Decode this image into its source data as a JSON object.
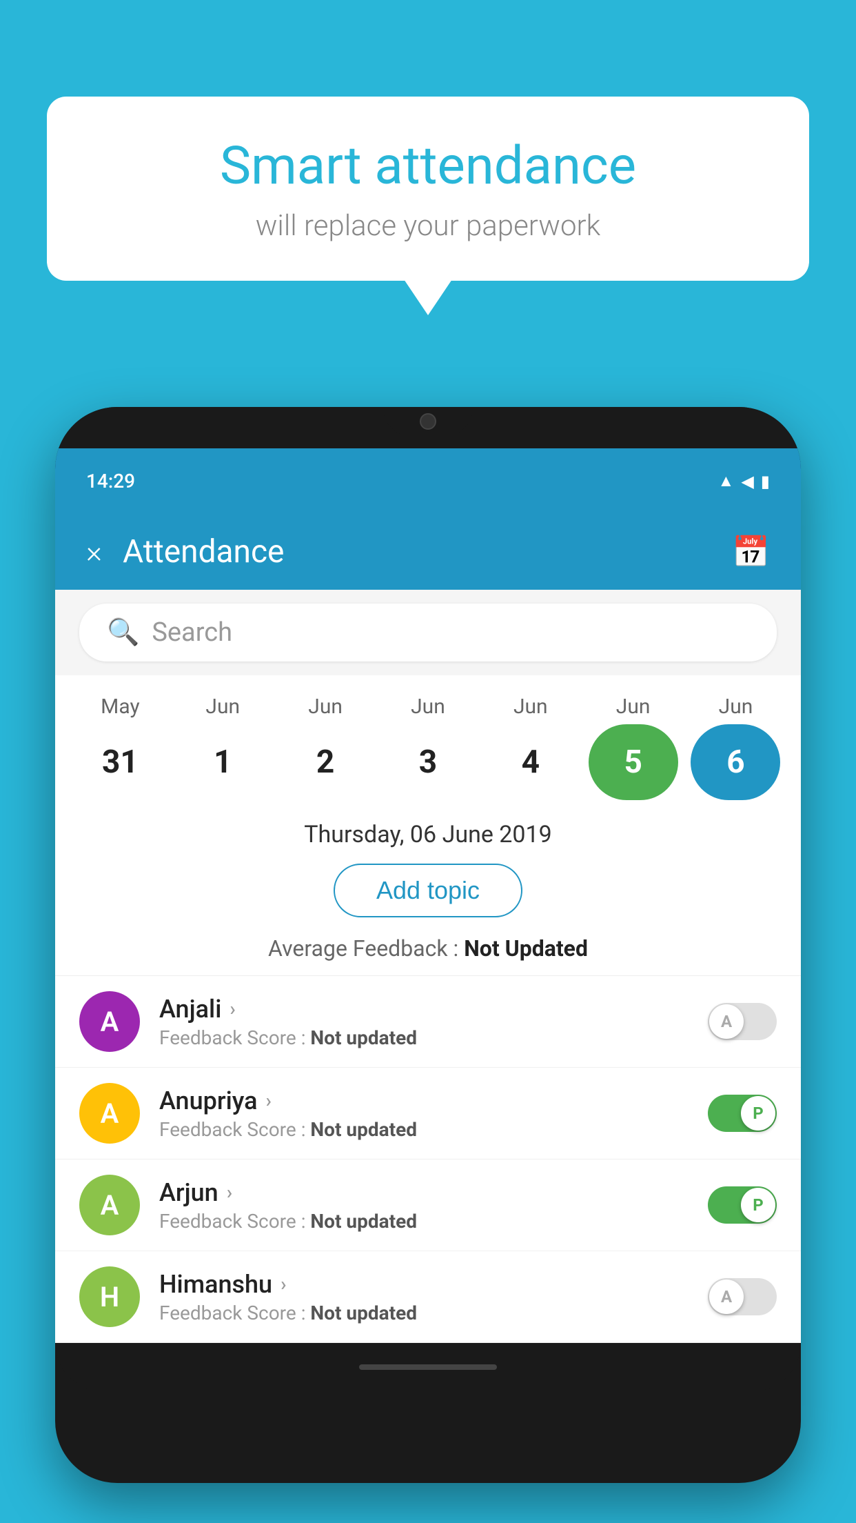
{
  "background_color": "#29b6d8",
  "speech_bubble": {
    "title": "Smart attendance",
    "subtitle": "will replace your paperwork"
  },
  "status_bar": {
    "time": "14:29",
    "icons": [
      "wifi",
      "signal",
      "battery"
    ]
  },
  "app_bar": {
    "title": "Attendance",
    "close_label": "×"
  },
  "search": {
    "placeholder": "Search"
  },
  "calendar": {
    "months": [
      "May",
      "Jun",
      "Jun",
      "Jun",
      "Jun",
      "Jun",
      "Jun"
    ],
    "dates": [
      "31",
      "1",
      "2",
      "3",
      "4",
      "5",
      "6"
    ],
    "today_index": 5,
    "selected_index": 6
  },
  "selected_date": "Thursday, 06 June 2019",
  "add_topic_label": "Add topic",
  "average_feedback": {
    "label": "Average Feedback : ",
    "value": "Not Updated"
  },
  "students": [
    {
      "name": "Anjali",
      "avatar_letter": "A",
      "avatar_color": "#9c27b0",
      "feedback_label": "Feedback Score : ",
      "feedback_value": "Not updated",
      "toggle": "off",
      "toggle_letter": "A"
    },
    {
      "name": "Anupriya",
      "avatar_letter": "A",
      "avatar_color": "#ffc107",
      "feedback_label": "Feedback Score : ",
      "feedback_value": "Not updated",
      "toggle": "on",
      "toggle_letter": "P"
    },
    {
      "name": "Arjun",
      "avatar_letter": "A",
      "avatar_color": "#8bc34a",
      "feedback_label": "Feedback Score : ",
      "feedback_value": "Not updated",
      "toggle": "on",
      "toggle_letter": "P"
    },
    {
      "name": "Himanshu",
      "avatar_letter": "H",
      "avatar_color": "#8bc34a",
      "feedback_label": "Feedback Score : ",
      "feedback_value": "Not updated",
      "toggle": "off",
      "toggle_letter": "A"
    }
  ]
}
